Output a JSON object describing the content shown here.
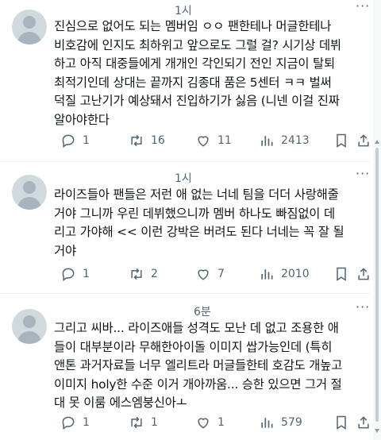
{
  "tweets": [
    {
      "time": "1시",
      "lines": [
        "진심으로 없어도 되는 멤버임 ㅇㅇ 팬한테나 머글한테나",
        "비호감에 인지도 최하위고 앞으로도 그럴 걸? 시기상 데뷔",
        "하고 아직 대중들에게 개개인 각인되기 전인 지금이 탈퇴",
        "최적기인데 상대는 끝까지 김종대 품은 5센터 ㅋㅋ 벌써",
        "덕질 고난기가 예상돼서 진입하기가 싫음 (니넨 이걸 진짜",
        "알아야한다"
      ],
      "replies": "1",
      "retweets": "16",
      "likes": "11",
      "views": "2413"
    },
    {
      "time": "1시",
      "lines": [
        "라이즈들아 팬들은 저런 애 없는 너네 팀을 더더 사랑해줄",
        "거야 그니까 우린 데뷔했으니까 멤버 하나도 빠짐없이 데",
        "리고 가야해 << 이런 강박은 버려도 된다 너네는 꼭 잘 될",
        "거야"
      ],
      "replies": "1",
      "retweets": "2",
      "likes": "7",
      "views": "2010"
    },
    {
      "time": "6분",
      "lines": [
        "그리고 씨바... 라이즈애들 성격도 모난 데 없고 조용한 애",
        "들이 대부분이라 무해한아이돌 이미지 쌉가능인데 (특히",
        "앤톤 과거자료들 너무 엘리트라 머글들한테 호감도 개높고",
        "이미지 holy한 수준 이거 개아까움... 승한 있으면 그거 절",
        "대 못 이룸 에스엠붕신아ㅗ"
      ],
      "replies": "1",
      "retweets": "1",
      "likes": "1",
      "views": "579"
    }
  ],
  "icons": {
    "reply": "reply-icon",
    "retweet": "retweet-icon",
    "like": "heart-icon",
    "views": "views-icon",
    "bookmark": "bookmark-icon",
    "share": "share-icon",
    "avatar": "default-avatar",
    "more": "more-icon"
  },
  "colors": {
    "text": "#0f1419",
    "secondary": "#536471",
    "divider": "#eff3f4",
    "avatar": "#cfd9de"
  }
}
